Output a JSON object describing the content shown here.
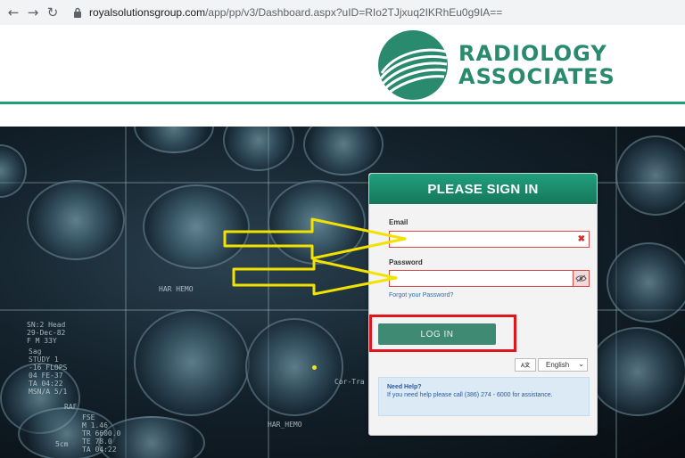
{
  "browser": {
    "url_host": "royalsolutionsgroup.com",
    "url_path": "/app/pp/v3/Dashboard.aspx?uID=RIo2TJjxuq2IKRhEu0g9IA==",
    "back_icon": "arrow-left-icon",
    "forward_icon": "arrow-right-icon",
    "reload_icon": "reload-icon",
    "lock_icon": "lock-icon"
  },
  "header": {
    "logo_line1": "RADIOLOGY",
    "logo_line2": "ASSOCIATES",
    "brand_color": "#2a8a6e"
  },
  "hero": {
    "film_labels": [
      "HAR HEMO",
      "HAR_HEMO",
      "Cor-Tra",
      "RAF",
      "FSE\nM 1.46\nTR 6600.0\nTE 78.0\nTA 04:22",
      "Sag\nSTUDY 1\n-16 FLOPS\n04 FE-37\nTA 04:22\nMSN/A 5/1",
      "SN:2 Head\n29-Dec-82\nF M 33Y",
      "5cm"
    ]
  },
  "login": {
    "title": "PLEASE SIGN IN",
    "email_label": "Email",
    "email_value": "",
    "email_clear_icon": "close-x-icon",
    "password_label": "Password",
    "password_value": "",
    "password_toggle_icon": "eye-slash-icon",
    "forgot_link": "Forgot your Password?",
    "login_button": "LOG IN",
    "language_icon": "translate-icon",
    "language_icon_text": "A文",
    "language_value": "English",
    "help_title": "Need Help?",
    "help_text": "If you need help please call (386) 274 - 6000 for assistance."
  },
  "annotations": {
    "arrow_color": "#f2e200",
    "highlight_color": "#e0161b"
  }
}
